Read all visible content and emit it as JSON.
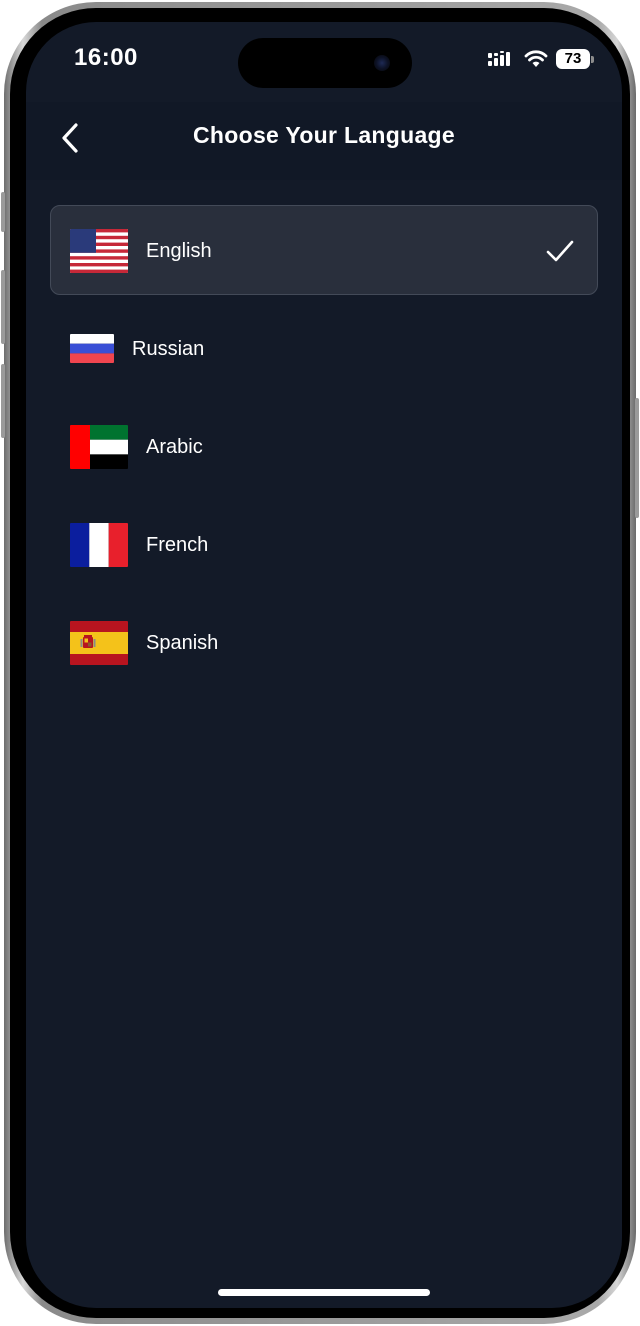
{
  "status_bar": {
    "time": "16:00",
    "battery": "73",
    "icons": [
      "signal-icon",
      "wifi-icon",
      "battery-icon"
    ]
  },
  "header": {
    "title": "Choose Your Language",
    "back_icon": "chevron-left-icon"
  },
  "languages": [
    {
      "label": "English",
      "flag": "us-flag-icon",
      "selected": true
    },
    {
      "label": "Russian",
      "flag": "russia-flag-icon",
      "selected": false
    },
    {
      "label": "Arabic",
      "flag": "uae-flag-icon",
      "selected": false
    },
    {
      "label": "French",
      "flag": "france-flag-icon",
      "selected": false
    },
    {
      "label": "Spanish",
      "flag": "spain-flag-icon",
      "selected": false
    }
  ],
  "selected_icon": "checkmark-icon",
  "colors": {
    "background": "#131a28",
    "header_background": "#111826",
    "selected_row": "#292f3c",
    "text": "#ffffff"
  }
}
